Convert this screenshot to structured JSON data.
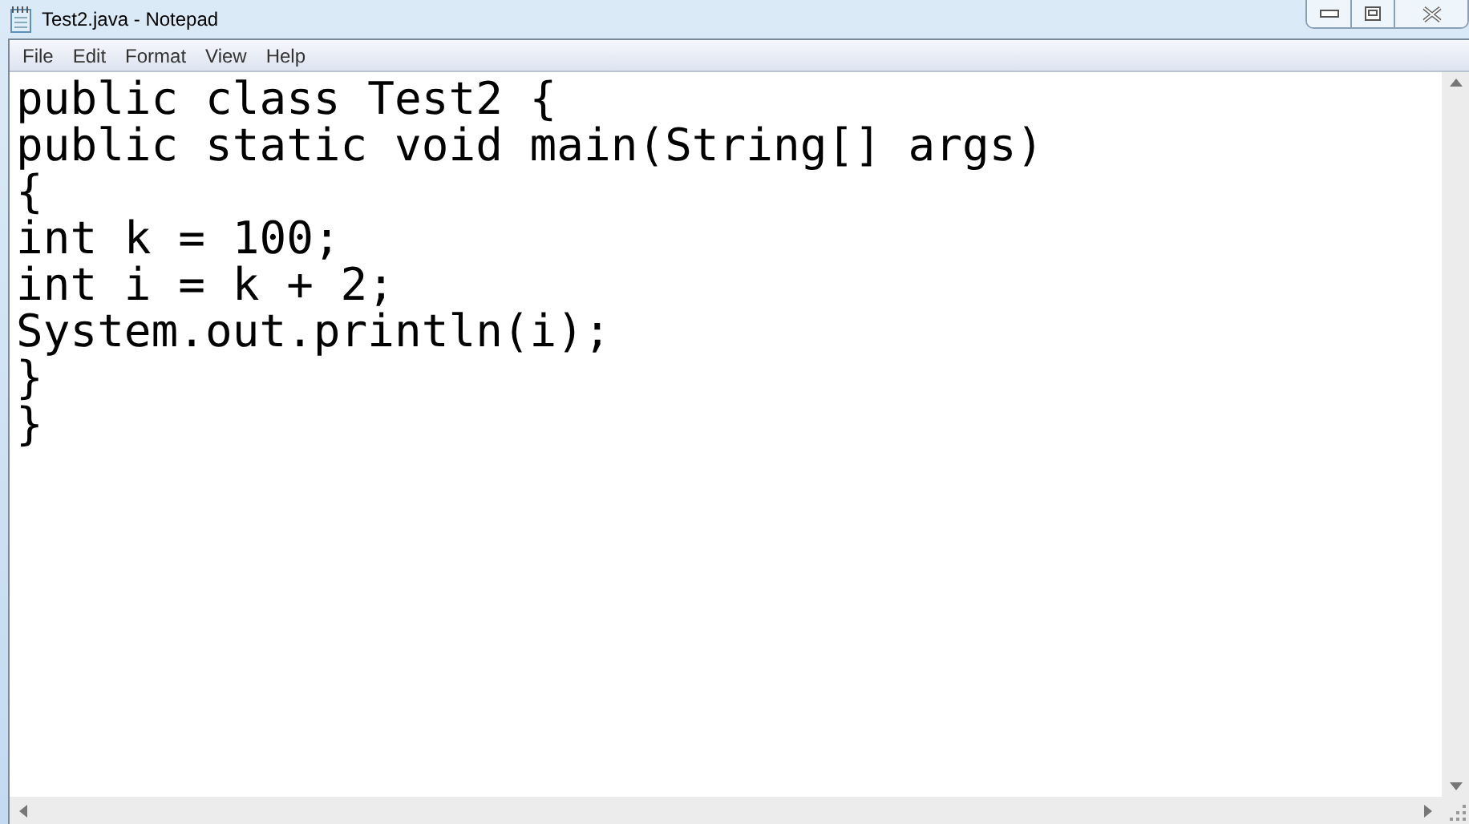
{
  "window": {
    "title": "Test2.java - Notepad"
  },
  "menu": [
    "File",
    "Edit",
    "Format",
    "View",
    "Help"
  ],
  "editor": {
    "lines": [
      "public class Test2 {",
      "public static void main(String[] args)",
      "{",
      "int k = 100;",
      "int i = k + 2;",
      "System.out.println(i);",
      "}",
      "}"
    ]
  }
}
